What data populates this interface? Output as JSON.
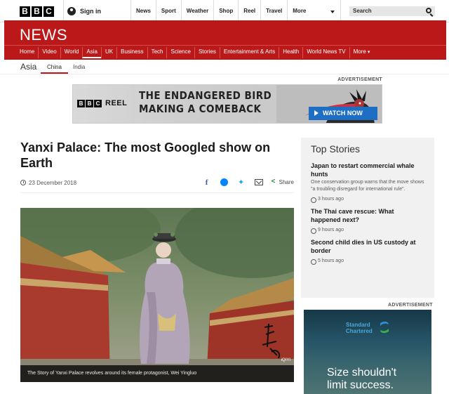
{
  "topbar": {
    "logo_letters": [
      "B",
      "B",
      "C"
    ],
    "signin_label": "Sign in",
    "nav": [
      "News",
      "Sport",
      "Weather",
      "Shop",
      "Reel",
      "Travel",
      "More"
    ],
    "search_placeholder": "Search"
  },
  "news_header": {
    "title": "NEWS",
    "nav": [
      "Home",
      "Video",
      "World",
      "Asia",
      "UK",
      "Business",
      "Tech",
      "Science",
      "Stories",
      "Entertainment & Arts",
      "Health",
      "World News TV",
      "More"
    ],
    "active": "Asia",
    "brand_color": "#bb1919"
  },
  "subnav": {
    "region": "Asia",
    "items": [
      "China",
      "India"
    ],
    "active": "China"
  },
  "top_ad": {
    "label": "ADVERTISEMENT",
    "logo_letters": [
      "B",
      "B",
      "C"
    ],
    "logo_word": "REEL",
    "line1": "THE ENDANGERED BIRD",
    "line2": "MAKING A COMEBACK",
    "cta": "WATCH NOW"
  },
  "article": {
    "headline": "Yanxi Palace: The most Googled show on Earth",
    "date": "23 December 2018",
    "share_label": "Share",
    "caption": "The Story of Yanxi Palace revolves around its female protagonist, Wei Yingluo",
    "watermark": "iQIYI"
  },
  "top_stories": {
    "title": "Top Stories",
    "items": [
      {
        "headline": "Japan to restart commercial whale hunts",
        "summary": "One conservation group warns that the move shows \"a troubling disregard for international rule\".",
        "time": "3 hours ago"
      },
      {
        "headline": "The Thai cave rescue: What happened next?",
        "time": "9 hours ago"
      },
      {
        "headline": "Second child dies in US custody at border",
        "time": "5 hours ago"
      }
    ]
  },
  "side_ad": {
    "label": "ADVERTISEMENT",
    "brand_line1": "Standard",
    "brand_line2": "Chartered",
    "text_line1": "Size shouldn't",
    "text_line2": "limit success."
  }
}
